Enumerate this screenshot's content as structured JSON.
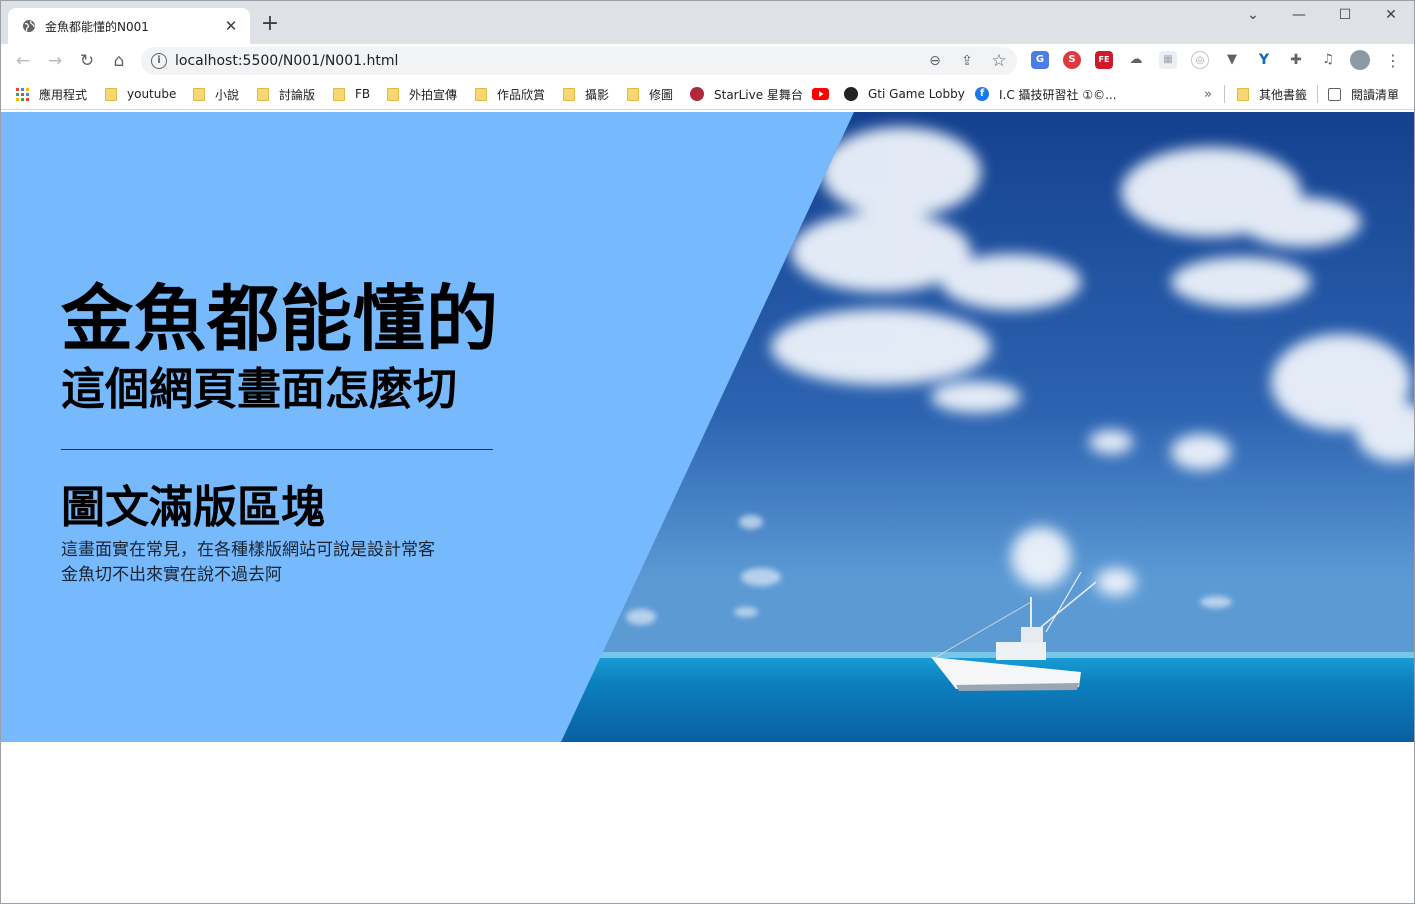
{
  "browser": {
    "tab_title": "金魚都能懂的N001",
    "tab_close": "✕",
    "new_tab": "+",
    "url": "localhost:5500/N001/N001.html",
    "window_controls": {
      "dropdown": "⌄",
      "minimize": "—",
      "maximize": "☐",
      "close": "✕"
    },
    "nav": {
      "back": "←",
      "forward": "→",
      "reload": "↻",
      "home": "⌂"
    },
    "menu": "⋮",
    "info_icon": "i",
    "zoom_icon": "⊖",
    "share_icon": "⇪",
    "star_icon": "☆"
  },
  "bookmarks": {
    "items": [
      {
        "label": "應用程式",
        "icon": "apps-grid-icon"
      },
      {
        "label": "youtube",
        "icon": "folder-icon"
      },
      {
        "label": "小說",
        "icon": "folder-icon"
      },
      {
        "label": "討論版",
        "icon": "folder-icon"
      },
      {
        "label": "FB",
        "icon": "folder-icon"
      },
      {
        "label": "外拍宣傳",
        "icon": "folder-icon"
      },
      {
        "label": "作品欣賞",
        "icon": "folder-icon"
      },
      {
        "label": "攝影",
        "icon": "folder-icon"
      },
      {
        "label": "修圖",
        "icon": "folder-icon"
      },
      {
        "label": "StarLive 星舞台",
        "icon": "starlive-icon"
      },
      {
        "label": "",
        "icon": "youtube-icon"
      },
      {
        "label": "Gti Game Lobby",
        "icon": "game-icon"
      },
      {
        "label": "I.C 攝技研習社 ①©...",
        "icon": "facebook-icon"
      }
    ],
    "overflow": "»",
    "other": "其他書籤",
    "reading_list": "閱讀清單"
  },
  "hero": {
    "title": "金魚都能懂的",
    "subtitle": "這個網頁畫面怎麼切",
    "section_title": "圖文滿版區塊",
    "body_line1": "這畫面實在常見，在各種樣版網站可說是設計常客",
    "body_line2": "金魚切不出來實在說不過去阿",
    "panel_color": "#76b9fc"
  }
}
